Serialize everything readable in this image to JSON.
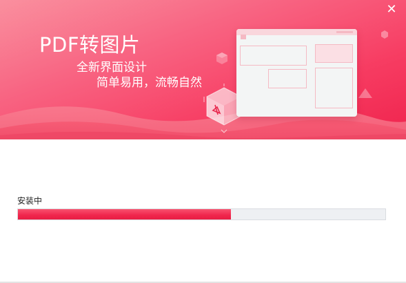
{
  "window": {
    "close_glyph": "✕"
  },
  "banner": {
    "title": "PDF转图片",
    "tagline_line1": "全新界面设计",
    "tagline_line2": "简单易用，流畅自然",
    "gradient_start": "#f86a7e",
    "gradient_end": "#f0234d",
    "illustration_icon": "pdf-cube-icon"
  },
  "install": {
    "status_label": "安装中",
    "progress_fraction": 0.58,
    "progress_fill_color": "#f0264c",
    "progress_track_color": "#eef0f3"
  }
}
